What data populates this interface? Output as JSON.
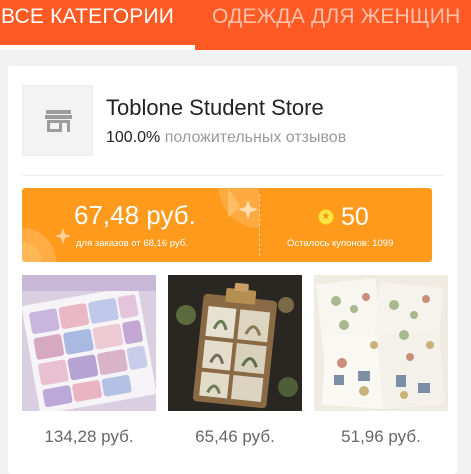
{
  "tabs": [
    {
      "label": "ВСЕ КАТЕГОРИИ",
      "active": true
    },
    {
      "label": "ОДЕЖДА ДЛЯ ЖЕНЩИН",
      "active": false
    }
  ],
  "store": {
    "icon": "storefront-icon",
    "name": "Toblone Student Store",
    "rating_percent": "100.0%",
    "rating_label": "положительных отзывов"
  },
  "coupon": {
    "amount": "67,48 руб.",
    "condition": "для заказов от 68,16 руб.",
    "coins_icon": "coin-icon",
    "coins_value": "50",
    "coupons_left": "Осталось купонов: 1099"
  },
  "products": [
    {
      "image": "washi-tape-rolls-image",
      "price": "134,28 руб."
    },
    {
      "image": "stamp-stickers-clipboard-image",
      "price": "65,46 руб."
    },
    {
      "image": "sticker-sheets-image",
      "price": "51,96 руб."
    }
  ],
  "colors": {
    "brand": "#ff5a24",
    "coupon": "#ff9a1d",
    "coin": "#ffe14a"
  }
}
